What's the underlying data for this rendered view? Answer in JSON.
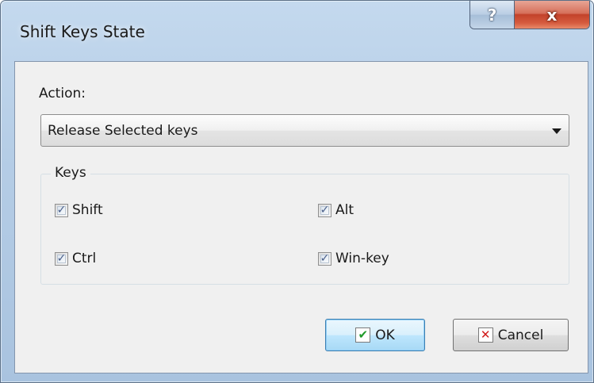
{
  "window": {
    "title": "Shift Keys State",
    "help_glyph": "?",
    "close_glyph": "x"
  },
  "action": {
    "label": "Action:",
    "selected": "Release Selected keys"
  },
  "keys_group": {
    "legend": "Keys",
    "items": [
      {
        "label": "Shift",
        "checked": true
      },
      {
        "label": "Alt",
        "checked": true
      },
      {
        "label": "Ctrl",
        "checked": true
      },
      {
        "label": "Win-key",
        "checked": true
      }
    ]
  },
  "buttons": {
    "ok": "OK",
    "cancel": "Cancel"
  },
  "glyphs": {
    "check": "✓",
    "ok_icon": "✔",
    "cancel_icon": "✕"
  },
  "colors": {
    "ok_icon": "#1f9a2a",
    "cancel_icon": "#d11c1c",
    "close_button": "#c2422a"
  }
}
